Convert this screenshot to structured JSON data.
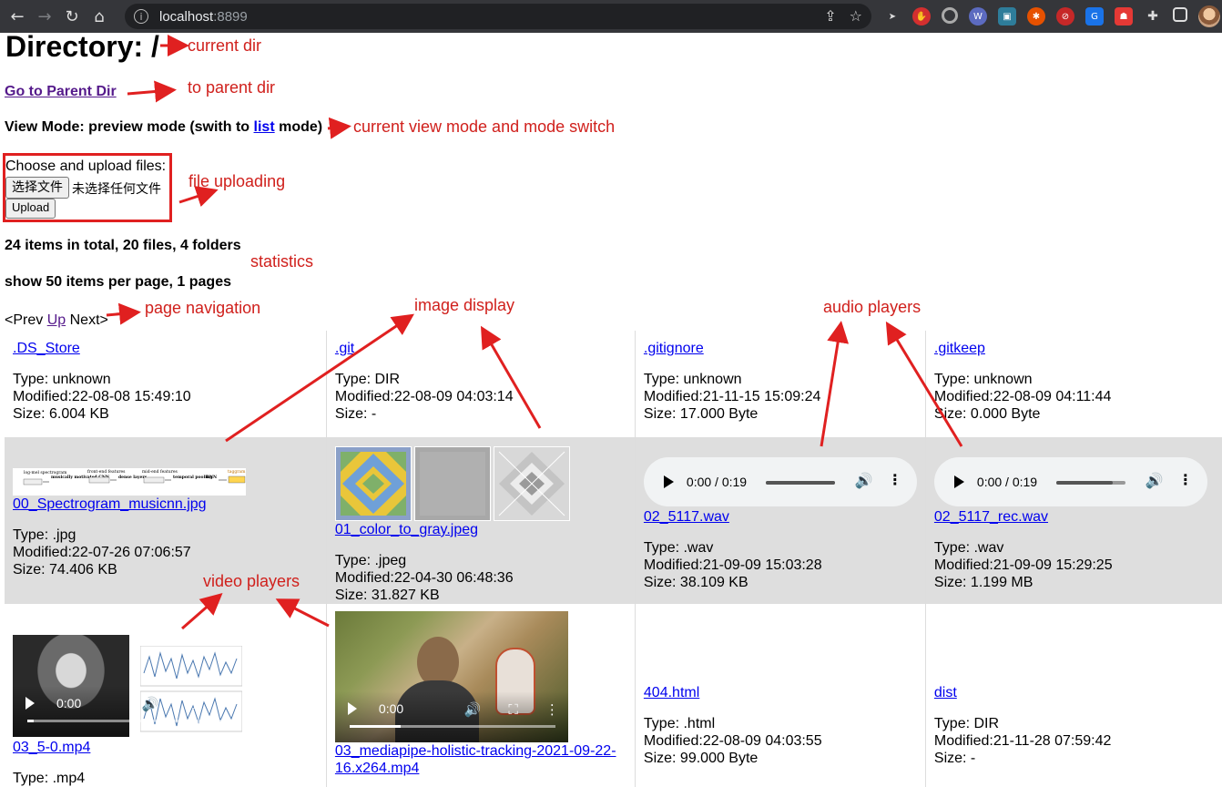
{
  "browser": {
    "host": "localhost",
    "port": ":8899",
    "extension_labels": [
      "G"
    ]
  },
  "page": {
    "title": "Directory: /",
    "parent_link": "Go to Parent Dir",
    "view_mode_prefix": "View Mode: preview mode (swith to ",
    "view_mode_link": "list",
    "view_mode_suffix": " mode)",
    "upload_label": "Choose and upload files:",
    "choose_button": "选择文件",
    "no_file_text": "未选择任何文件",
    "upload_button": "Upload",
    "stats_line": "24 items in total, 20 files, 4 folders",
    "per_page_line": "show 50 items per page, 1 pages",
    "pager": {
      "prev": "<Prev",
      "up": "Up",
      "next": "Next>"
    }
  },
  "annotations": {
    "current_dir": "current dir",
    "to_parent": "to parent dir",
    "view_mode": "current view mode and mode switch",
    "file_uploading": "file uploading",
    "statistics": "statistics",
    "page_navigation": "page navigation",
    "image_display": "image display",
    "audio_players": "audio players",
    "video_players": "video players"
  },
  "items": [
    {
      "name": ".DS_Store",
      "type": "Type: unknown",
      "modified": "Modified:22-08-08 15:49:10",
      "size": "Size: 6.004 KB"
    },
    {
      "name": ".git",
      "type": "Type: DIR",
      "modified": "Modified:22-08-09 04:03:14",
      "size": "Size: -"
    },
    {
      "name": ".gitignore",
      "type": "Type: unknown",
      "modified": "Modified:21-11-15 15:09:24",
      "size": "Size: 17.000 Byte"
    },
    {
      "name": ".gitkeep",
      "type": "Type: unknown",
      "modified": "Modified:22-08-09 04:11:44",
      "size": "Size: 0.000 Byte"
    },
    {
      "name": "00_Spectrogram_musicnn.jpg",
      "type": "Type: .jpg",
      "modified": "Modified:22-07-26 07:06:57",
      "size": "Size: 74.406 KB"
    },
    {
      "name": "01_color_to_gray.jpeg",
      "type": "Type: .jpeg",
      "modified": "Modified:22-04-30 06:48:36",
      "size": "Size: 31.827 KB"
    },
    {
      "name": "02_5117.wav",
      "type": "Type: .wav",
      "modified": "Modified:21-09-09 15:03:28",
      "size": "Size: 38.109 KB",
      "player_time": "0:00 / 0:19",
      "volume_level": 1.0
    },
    {
      "name": "02_5117_rec.wav",
      "type": "Type: .wav",
      "modified": "Modified:21-09-09 15:29:25",
      "size": "Size: 1.199 MB",
      "player_time": "0:00 / 0:19",
      "volume_level": 0.82
    },
    {
      "name": "03_5-0.mp4",
      "type": "Type: .mp4",
      "player_time": "0:00"
    },
    {
      "name": "03_mediapipe-holistic-tracking-2021-09-22-16.x264.mp4",
      "player_time": "0:00"
    },
    {
      "name": "404.html",
      "type": "Type: .html",
      "modified": "Modified:22-08-09 04:03:55",
      "size": "Size: 99.000 Byte"
    },
    {
      "name": "dist",
      "type": "Type: DIR",
      "modified": "Modified:21-11-28 07:59:42",
      "size": "Size: -"
    }
  ],
  "spectrogram_labels": {
    "t1": "log-mel spectrogram",
    "t2": "musically motivated CNN",
    "t3": "front-end features",
    "t4": "dense layers",
    "t5": "mid-end features",
    "t6": "temporal pooling",
    "t7": "DNN",
    "t8": "taggram"
  },
  "colors": {
    "link": "#0000ee",
    "visited": "#551a8b",
    "annotation": "#d0201c",
    "row_gray": "#dedede"
  }
}
